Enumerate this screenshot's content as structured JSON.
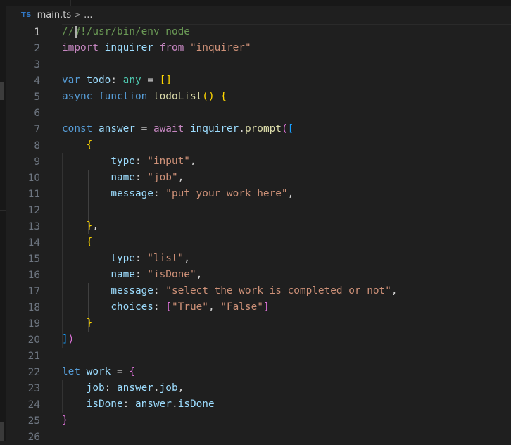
{
  "breadcrumb": {
    "lang_badge": "TS",
    "file": "main.ts",
    "chevron": ">",
    "more": "..."
  },
  "editor": {
    "active_line": 1,
    "lines": [
      {
        "n": "1",
        "tokens": [
          {
            "t": "//#!/usr/bin/env node",
            "c": "comment"
          }
        ]
      },
      {
        "n": "2",
        "tokens": [
          {
            "t": "import",
            "c": "kw"
          },
          {
            "t": " ",
            "c": "plain"
          },
          {
            "t": "inquirer",
            "c": "var"
          },
          {
            "t": " ",
            "c": "plain"
          },
          {
            "t": "from",
            "c": "kw"
          },
          {
            "t": " ",
            "c": "plain"
          },
          {
            "t": "\"inquirer\"",
            "c": "str"
          }
        ]
      },
      {
        "n": "3",
        "tokens": []
      },
      {
        "n": "4",
        "tokens": [
          {
            "t": "var",
            "c": "storage"
          },
          {
            "t": " ",
            "c": "plain"
          },
          {
            "t": "todo",
            "c": "var"
          },
          {
            "t": ": ",
            "c": "plain"
          },
          {
            "t": "any",
            "c": "type"
          },
          {
            "t": " = ",
            "c": "plain"
          },
          {
            "t": "[]",
            "c": "b1"
          }
        ]
      },
      {
        "n": "5",
        "tokens": [
          {
            "t": "async",
            "c": "storage"
          },
          {
            "t": " ",
            "c": "plain"
          },
          {
            "t": "function",
            "c": "storage"
          },
          {
            "t": " ",
            "c": "plain"
          },
          {
            "t": "todoList",
            "c": "fn"
          },
          {
            "t": "()",
            "c": "b1"
          },
          {
            "t": " ",
            "c": "plain"
          },
          {
            "t": "{",
            "c": "b1"
          }
        ]
      },
      {
        "n": "6",
        "tokens": []
      },
      {
        "n": "7",
        "tokens": [
          {
            "t": "const",
            "c": "storage"
          },
          {
            "t": " ",
            "c": "plain"
          },
          {
            "t": "answer",
            "c": "var"
          },
          {
            "t": " = ",
            "c": "plain"
          },
          {
            "t": "await",
            "c": "kw"
          },
          {
            "t": " ",
            "c": "plain"
          },
          {
            "t": "inquirer",
            "c": "var"
          },
          {
            "t": ".",
            "c": "plain"
          },
          {
            "t": "prompt",
            "c": "fn"
          },
          {
            "t": "(",
            "c": "b2"
          },
          {
            "t": "[",
            "c": "b3"
          }
        ]
      },
      {
        "n": "8",
        "tokens": [
          {
            "t": "    ",
            "c": "plain"
          },
          {
            "t": "{",
            "c": "b1"
          }
        ]
      },
      {
        "n": "9",
        "tokens": [
          {
            "t": "        ",
            "c": "plain"
          },
          {
            "t": "type",
            "c": "var"
          },
          {
            "t": ": ",
            "c": "plain"
          },
          {
            "t": "\"input\"",
            "c": "str"
          },
          {
            "t": ",",
            "c": "plain"
          }
        ]
      },
      {
        "n": "10",
        "tokens": [
          {
            "t": "        ",
            "c": "plain"
          },
          {
            "t": "name",
            "c": "var"
          },
          {
            "t": ": ",
            "c": "plain"
          },
          {
            "t": "\"job\"",
            "c": "str"
          },
          {
            "t": ",",
            "c": "plain"
          }
        ]
      },
      {
        "n": "11",
        "tokens": [
          {
            "t": "        ",
            "c": "plain"
          },
          {
            "t": "message",
            "c": "var"
          },
          {
            "t": ": ",
            "c": "plain"
          },
          {
            "t": "\"put your work here\"",
            "c": "str"
          },
          {
            "t": ",",
            "c": "plain"
          }
        ]
      },
      {
        "n": "12",
        "tokens": []
      },
      {
        "n": "13",
        "tokens": [
          {
            "t": "    ",
            "c": "plain"
          },
          {
            "t": "}",
            "c": "b1"
          },
          {
            "t": ",",
            "c": "plain"
          }
        ]
      },
      {
        "n": "14",
        "tokens": [
          {
            "t": "    ",
            "c": "plain"
          },
          {
            "t": "{",
            "c": "b1"
          }
        ]
      },
      {
        "n": "15",
        "tokens": [
          {
            "t": "        ",
            "c": "plain"
          },
          {
            "t": "type",
            "c": "var"
          },
          {
            "t": ": ",
            "c": "plain"
          },
          {
            "t": "\"list\"",
            "c": "str"
          },
          {
            "t": ",",
            "c": "plain"
          }
        ]
      },
      {
        "n": "16",
        "tokens": [
          {
            "t": "        ",
            "c": "plain"
          },
          {
            "t": "name",
            "c": "var"
          },
          {
            "t": ": ",
            "c": "plain"
          },
          {
            "t": "\"isDone\"",
            "c": "str"
          },
          {
            "t": ",",
            "c": "plain"
          }
        ]
      },
      {
        "n": "17",
        "tokens": [
          {
            "t": "        ",
            "c": "plain"
          },
          {
            "t": "message",
            "c": "var"
          },
          {
            "t": ": ",
            "c": "plain"
          },
          {
            "t": "\"select the work is completed or not\"",
            "c": "str"
          },
          {
            "t": ",",
            "c": "plain"
          }
        ]
      },
      {
        "n": "18",
        "tokens": [
          {
            "t": "        ",
            "c": "plain"
          },
          {
            "t": "choices",
            "c": "var"
          },
          {
            "t": ": ",
            "c": "plain"
          },
          {
            "t": "[",
            "c": "b2"
          },
          {
            "t": "\"True\"",
            "c": "str"
          },
          {
            "t": ", ",
            "c": "plain"
          },
          {
            "t": "\"False\"",
            "c": "str"
          },
          {
            "t": "]",
            "c": "b2"
          }
        ]
      },
      {
        "n": "19",
        "tokens": [
          {
            "t": "    ",
            "c": "plain"
          },
          {
            "t": "}",
            "c": "b1"
          }
        ]
      },
      {
        "n": "20",
        "tokens": [
          {
            "t": "]",
            "c": "b3"
          },
          {
            "t": ")",
            "c": "b2"
          }
        ]
      },
      {
        "n": "21",
        "tokens": []
      },
      {
        "n": "22",
        "tokens": [
          {
            "t": "let",
            "c": "storage"
          },
          {
            "t": " ",
            "c": "plain"
          },
          {
            "t": "work",
            "c": "var"
          },
          {
            "t": " = ",
            "c": "plain"
          },
          {
            "t": "{",
            "c": "b2"
          }
        ]
      },
      {
        "n": "23",
        "tokens": [
          {
            "t": "    ",
            "c": "plain"
          },
          {
            "t": "job",
            "c": "var"
          },
          {
            "t": ": ",
            "c": "plain"
          },
          {
            "t": "answer",
            "c": "var"
          },
          {
            "t": ".",
            "c": "plain"
          },
          {
            "t": "job",
            "c": "var"
          },
          {
            "t": ",",
            "c": "plain"
          }
        ]
      },
      {
        "n": "24",
        "tokens": [
          {
            "t": "    ",
            "c": "plain"
          },
          {
            "t": "isDone",
            "c": "var"
          },
          {
            "t": ": ",
            "c": "plain"
          },
          {
            "t": "answer",
            "c": "var"
          },
          {
            "t": ".",
            "c": "plain"
          },
          {
            "t": "isDone",
            "c": "var"
          }
        ]
      },
      {
        "n": "25",
        "tokens": [
          {
            "t": "}",
            "c": "b2"
          }
        ]
      },
      {
        "n": "26",
        "tokens": []
      }
    ]
  },
  "colors": {
    "background": "#1f1f1f",
    "comment": "#6a9955",
    "keyword": "#c586c0",
    "storage": "#569cd6",
    "variable": "#9cdcfe",
    "string": "#ce9178",
    "function": "#dcdcaa",
    "type": "#4ec9b0",
    "ts_badge": "#3178c6"
  }
}
